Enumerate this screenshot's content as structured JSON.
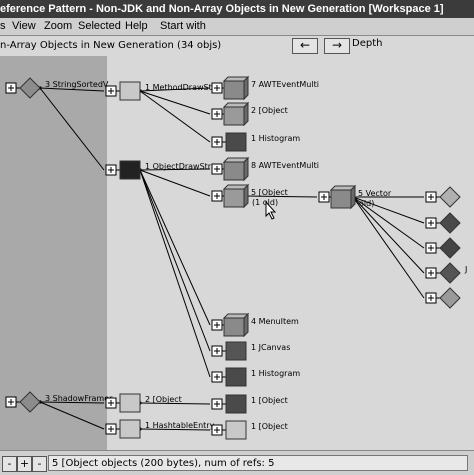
{
  "window": {
    "title": "eference Pattern  -  Non-JDK and Non-Array Objects in New Generation [Workspace 1]"
  },
  "menu": {
    "items": [
      "s",
      "View",
      "Zoom",
      "Selected",
      "Help",
      "Start with"
    ]
  },
  "toolbar": {
    "summary": "n-Array Objects in New Generation (34 objs)",
    "depth_label": "Depth"
  },
  "nav": {
    "back_icon": "left-arrow-icon",
    "forward_icon": "right-arrow-icon"
  },
  "graph": {
    "nodes": [
      {
        "label": "3 StringSortedV",
        "shape": "diamond",
        "color": "#8c8c8c"
      },
      {
        "label": "1 MethodDrawStr",
        "shape": "box",
        "color": "#c8c8c8"
      },
      {
        "label": "1 ObjectDrawStr",
        "shape": "box",
        "color": "#222222"
      },
      {
        "label": "7 AWTEventMulti",
        "shape": "cube",
        "color": "#8a8a8a"
      },
      {
        "label": "2 [Object",
        "shape": "cube",
        "color": "#9a9a9a"
      },
      {
        "label": "1 Histogram",
        "shape": "box",
        "color": "#4a4a4a"
      },
      {
        "label": "8 AWTEventMulti",
        "shape": "cube",
        "color": "#8a8a8a"
      },
      {
        "label": "5 [Object",
        "sublabel": "(1 old)",
        "shape": "cube",
        "color": "#9a9a9a"
      },
      {
        "label": "5 Vector",
        "sublabel": "old)",
        "shape": "cube",
        "color": "#8a8a8a"
      },
      {
        "label": "4 MenuItem",
        "shape": "cube",
        "color": "#8a8a8a"
      },
      {
        "label": "1 JCanvas",
        "shape": "box",
        "color": "#555555"
      },
      {
        "label": "1 Histogram",
        "shape": "box",
        "color": "#4a4a4a"
      },
      {
        "label": "3 ShadowFramer",
        "shape": "diamond",
        "color": "#8c8c8c"
      },
      {
        "label": "2 [Object",
        "shape": "box",
        "color": "#c8c8c8"
      },
      {
        "label": "1 HashtableEntry",
        "shape": "box",
        "color": "#c8c8c8"
      },
      {
        "label": "1 [Object",
        "shape": "box",
        "color": "#4a4a4a"
      },
      {
        "label": "1 [Object",
        "shape": "box",
        "color": "#c8c8c8"
      },
      {
        "label": "",
        "shape": "diamond",
        "color": "#b0b0b0"
      },
      {
        "label": "",
        "shape": "diamond",
        "color": "#4a4a4a"
      },
      {
        "label": "",
        "shape": "diamond",
        "color": "#444444"
      },
      {
        "label": "J",
        "shape": "diamond",
        "color": "#555555"
      },
      {
        "label": "",
        "shape": "diamond",
        "color": "#9a9a9a"
      }
    ]
  },
  "status": {
    "text": "5 [Object objects (200 bytes), num of refs: 5",
    "btn_dec": "-",
    "btn_inc": "+",
    "btn_menu": "-"
  }
}
